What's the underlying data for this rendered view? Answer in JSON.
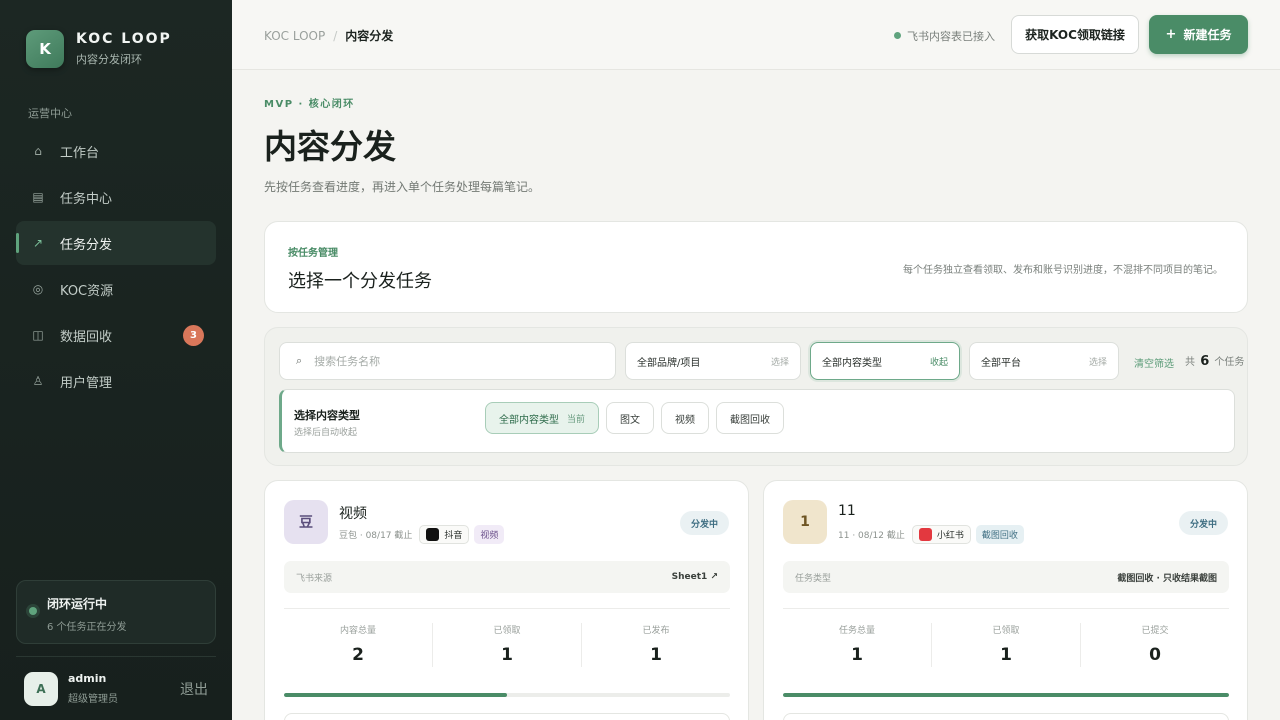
{
  "brand": {
    "logo_letter": "K",
    "title": "KOC LOOP",
    "subtitle": "内容分发闭环"
  },
  "sidebar": {
    "section_label": "运营中心",
    "items": [
      {
        "label": "工作台",
        "icon": "⌂",
        "icon_name": "home-icon",
        "active": false
      },
      {
        "label": "任务中心",
        "icon": "▤",
        "icon_name": "task-list-icon",
        "active": false
      },
      {
        "label": "任务分发",
        "icon": "↗",
        "icon_name": "dispatch-arrow-icon",
        "active": true
      },
      {
        "label": "KOC资源",
        "icon": "◎",
        "icon_name": "koc-resource-icon",
        "active": false
      },
      {
        "label": "数据回收",
        "icon": "◫",
        "icon_name": "data-recovery-icon",
        "active": false,
        "badge": "3"
      },
      {
        "label": "用户管理",
        "icon": "♙",
        "icon_name": "user-icon",
        "active": false
      }
    ],
    "status": {
      "title": "闭环运行中",
      "subtitle": "6 个任务正在分发"
    },
    "user": {
      "avatar": "A",
      "name": "admin",
      "role": "超级管理员",
      "logout": "退出"
    }
  },
  "topbar": {
    "breadcrumb_root": "KOC LOOP",
    "breadcrumb_sep": "/",
    "breadcrumb_current": "内容分发",
    "connection_status": "飞书内容表已接入",
    "link_button": "获取KOC领取链接",
    "new_button": "新建任务",
    "new_button_icon": "+"
  },
  "page": {
    "eyebrow": "MVP · 核心闭环",
    "title": "内容分发",
    "description": "先按任务查看进度，再进入单个任务处理每篇笔记。"
  },
  "manage_card": {
    "kicker": "按任务管理",
    "title": "选择一个分发任务",
    "note": "每个任务独立查看领取、发布和账号识别进度，不混排不同项目的笔记。"
  },
  "filters": {
    "search_placeholder": "搜索任务名称",
    "search_value": "",
    "brand_select": {
      "value": "全部品牌/项目",
      "action": "选择"
    },
    "type_select": {
      "value": "全部内容类型",
      "action": "收起"
    },
    "platform_select": {
      "value": "全部平台",
      "action": "选择"
    },
    "clear": "清空筛选",
    "total_prefix": "共",
    "total_count": "6",
    "total_suffix": "个任务"
  },
  "type_panel": {
    "title": "选择内容类型",
    "subtitle": "选择后自动收起",
    "chips": [
      {
        "label": "全部内容类型",
        "tag": "当前",
        "active": true
      },
      {
        "label": "图文",
        "tag": "",
        "active": false
      },
      {
        "label": "视频",
        "tag": "",
        "active": false
      },
      {
        "label": "截图回收",
        "tag": "",
        "active": false
      }
    ]
  },
  "tasks": [
    {
      "icon_letter": "豆",
      "icon_bg": "#e6e1f0",
      "icon_color": "#5b4e7c",
      "name": "视频",
      "meta": "豆包 · 08/17 截止",
      "platform": "抖音",
      "platform_icon_name": "douyin-icon",
      "platform_logo_color": "#111111",
      "type_tag": "视频",
      "type_tag_bg": "#f1ebf7",
      "type_tag_color": "#6a4f8a",
      "state": "分发中",
      "info_key": "飞书来源",
      "info_val": "Sheet1 ↗",
      "stats": [
        {
          "label": "内容总量",
          "value": "2"
        },
        {
          "label": "已领取",
          "value": "1"
        },
        {
          "label": "已发布",
          "value": "1"
        }
      ],
      "progress": 0.5
    },
    {
      "icon_letter": "1",
      "icon_bg": "#f0e5cc",
      "icon_color": "#6e5523",
      "name": "11",
      "meta": "11 · 08/12 截止",
      "platform": "小红书",
      "platform_icon_name": "xiaohongshu-icon",
      "platform_logo_color": "#e3383f",
      "type_tag": "截图回收",
      "type_tag_bg": "#e6f0f3",
      "type_tag_color": "#3e6e82",
      "state": "分发中",
      "info_key": "任务类型",
      "info_val": "截图回收 · 只收结果截图",
      "stats": [
        {
          "label": "任务总量",
          "value": "1"
        },
        {
          "label": "已领取",
          "value": "1"
        },
        {
          "label": "已提交",
          "value": "0"
        }
      ],
      "progress": 1.0
    }
  ]
}
